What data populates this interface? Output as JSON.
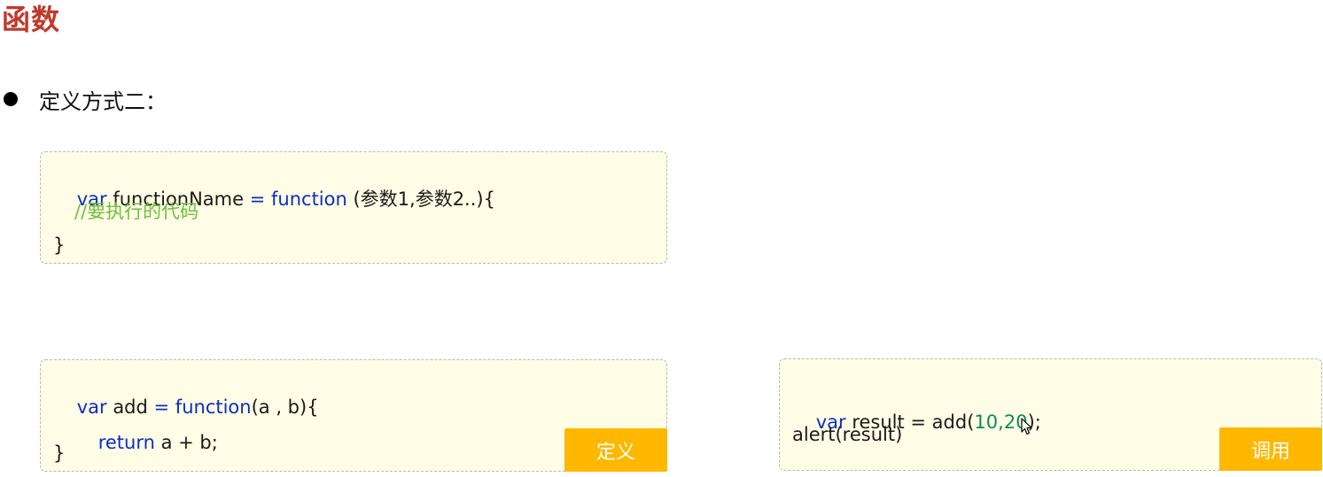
{
  "page": {
    "title": "函数"
  },
  "bullet": {
    "text": "定义方式二："
  },
  "box1": {
    "line1": {
      "var": "var",
      "name": " functionName ",
      "eq_func": "= function",
      "params": " (参数1,参数2..){"
    },
    "line2": "//要执行的代码",
    "line3": "}"
  },
  "box2": {
    "line1": {
      "var": "var",
      "name": " add ",
      "eq_func": "= function",
      "params": "(a , b){"
    },
    "line2": {
      "return_kw": "return",
      "expr": " a + b;"
    },
    "line3": "}",
    "tag": "定义"
  },
  "box3": {
    "line1": {
      "var": "var",
      "call": " result = add(",
      "n1": "10",
      "comma": ",",
      "n2": "20",
      "close": ");"
    },
    "line2": "alert(result)",
    "tag": "调用"
  },
  "colors": {
    "title": "#c0392b",
    "keyword": "#0a2fc4",
    "comment": "#6fbf3f",
    "number": "#0e8a5f",
    "box_bg": "#fffde5",
    "tag_bg": "#ffb700"
  },
  "icons": {
    "bullet": "filled-circle",
    "cursor": "mouse-pointer-icon"
  }
}
